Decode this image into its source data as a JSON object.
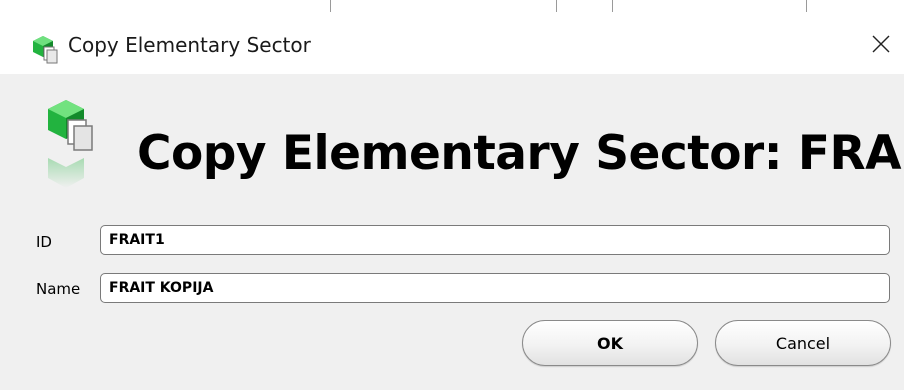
{
  "window": {
    "title": "Copy Elementary Sector",
    "close_icon": "close-icon",
    "app_icon": "elementary-sector-copy-icon"
  },
  "header": {
    "title": "Copy Elementary Sector: FRAIT",
    "icon": "elementary-sector-copy-icon"
  },
  "form": {
    "id_label": "ID",
    "id_value": "FRAIT1",
    "name_label": "Name",
    "name_value": "FRAIT KOPIJA"
  },
  "buttons": {
    "ok_label": "OK",
    "cancel_label": "Cancel"
  },
  "colors": {
    "accent_green": "#1fa83a",
    "dialog_background": "#f0f0f0",
    "titlebar_background": "#ffffff"
  }
}
